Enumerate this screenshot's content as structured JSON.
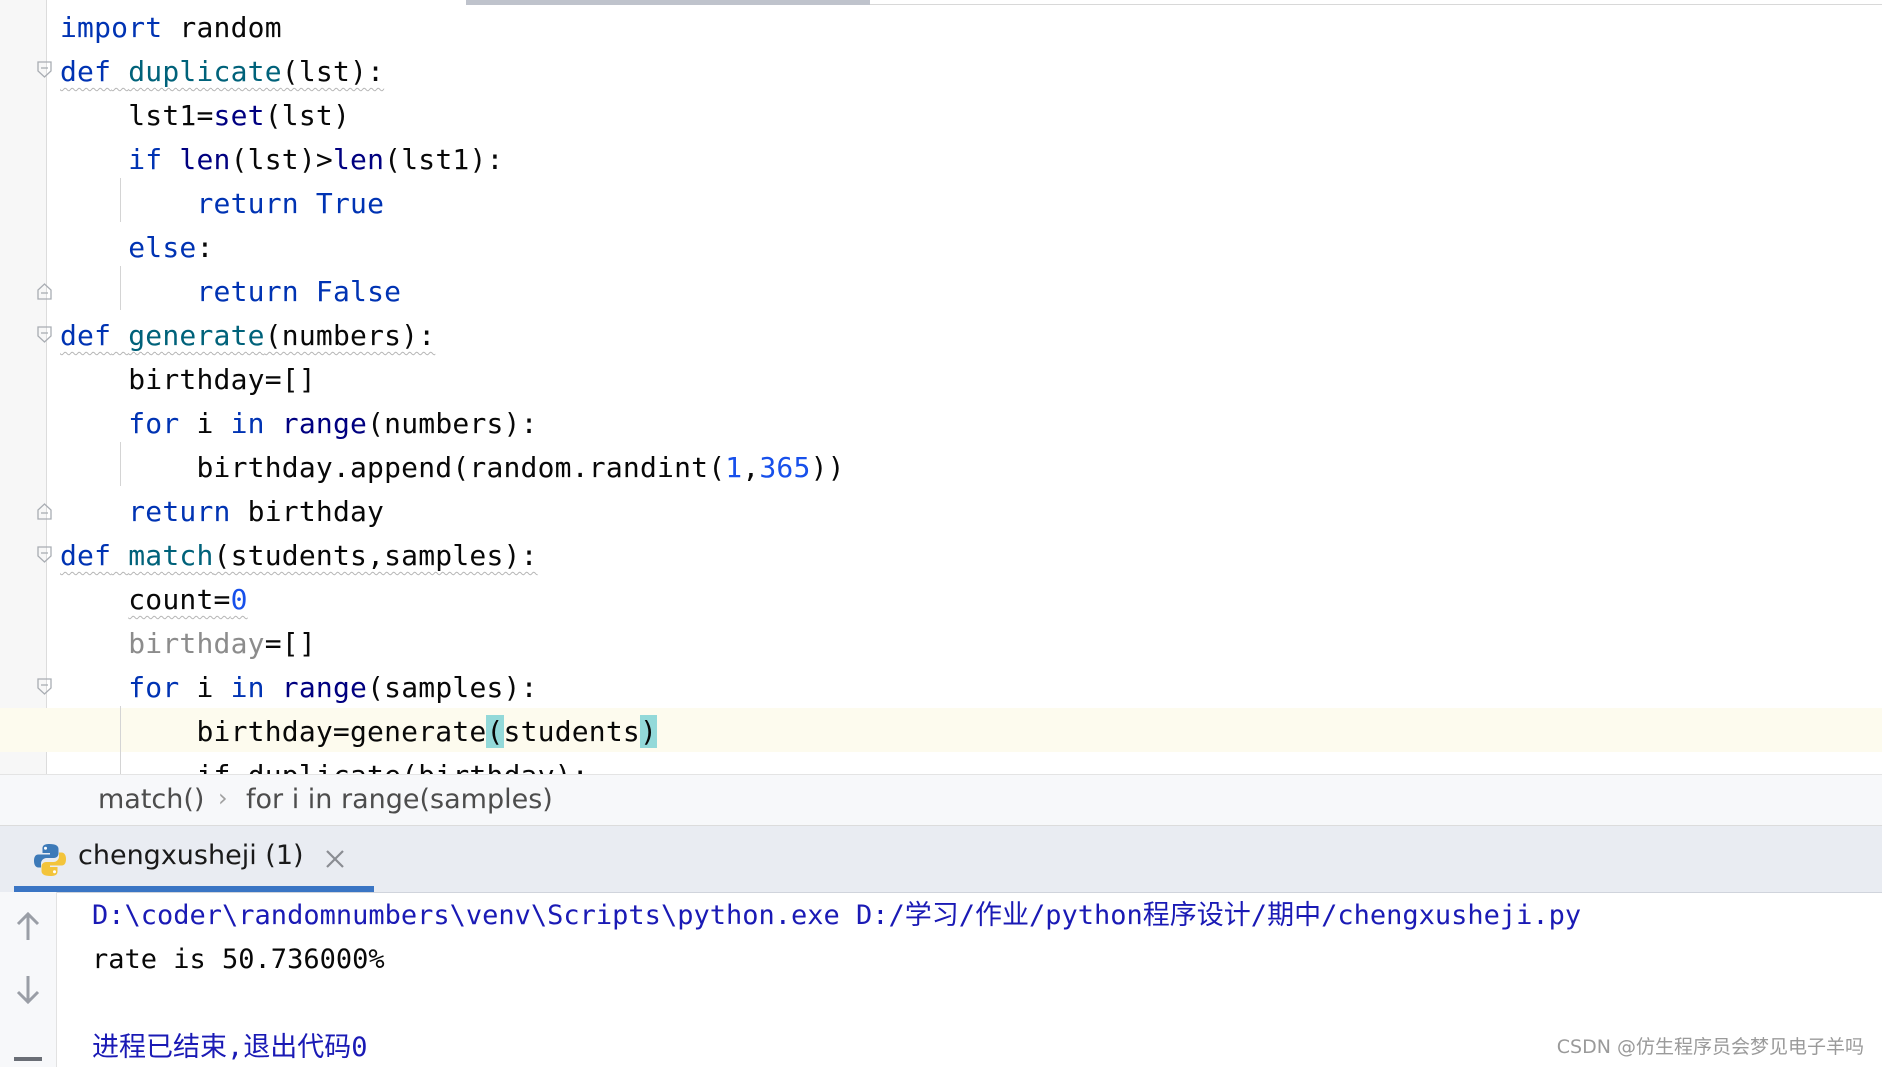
{
  "editor": {
    "lines": [
      "import random",
      "def duplicate(lst):",
      "    lst1=set(lst)",
      "    if len(lst)>len(lst1):",
      "        return True",
      "    else:",
      "        return False",
      "def generate(numbers):",
      "    birthday=[]",
      "    for i in range(numbers):",
      "        birthday.append(random.randint(1,365))",
      "    return birthday",
      "def match(students,samples):",
      "    count=0",
      "    birthday=[]",
      "    for i in range(samples):",
      "        birthday=generate(students)",
      "        if duplicate(birthday):"
    ],
    "tokens": {
      "import": "import",
      "random": "random",
      "def": "def",
      "duplicate": "duplicate",
      "lst_params": "(lst):",
      "lst1_assign": "lst1=",
      "set": "set",
      "lst_arg": "(lst)",
      "if": "if",
      "len": "len",
      "len_lst": "(lst)>",
      "len2": "len",
      "len_lst1": "(lst1):",
      "return": "return",
      "true": "True",
      "else": "else",
      "colon": ":",
      "false": "False",
      "generate": "generate",
      "numbers_params": "(numbers):",
      "birthday_init": "birthday=[]",
      "for": "for",
      "i": "i",
      "in": "in",
      "range": "range",
      "numbers_arg": "(numbers):",
      "append_pre": "birthday.append(random.randint(",
      "one": "1",
      "comma": ",",
      "n365": "365",
      "append_post": "))",
      "return_birthday": "birthday",
      "match": "match",
      "match_params": "(students,samples):",
      "count_assign": "count=",
      "zero": "0",
      "birthday_unused": "birthday",
      "eq_list": "=[]",
      "samples_arg": "(samples):",
      "gen_assign": "birthday=generate",
      "lparen": "(",
      "students": "students",
      "rparen": ")",
      "partial_if": "if duplicate(birthday):"
    }
  },
  "breadcrumb": {
    "items": [
      "match()",
      "for i in range(samples)"
    ],
    "separator": "›"
  },
  "run": {
    "tab_label": "chengxusheji (1)",
    "console_lines": [
      "D:\\coder\\randomnumbers\\venv\\Scripts\\python.exe D:/学习/作业/python程序设计/期中/chengxusheji.py",
      "rate is 50.736000%",
      "",
      "进程已结束,退出代码0"
    ]
  },
  "watermark": "CSDN @仿生程序员会梦见电子羊吗",
  "colors": {
    "keyword": "#0033b3",
    "function_name": "#00627a",
    "builtin": "#000080",
    "number": "#1750eb",
    "unused": "#8c8c8c",
    "tab_underline": "#3a75c4",
    "console_system": "#1a1ab5"
  }
}
